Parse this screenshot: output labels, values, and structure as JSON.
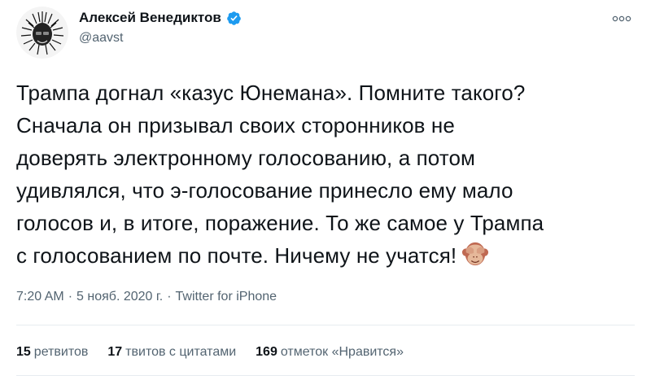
{
  "author": {
    "display_name": "Алексей Венедиктов",
    "handle": "@aavst",
    "verified_icon": "verified-badge-icon",
    "avatar_icon": "avatar-portrait"
  },
  "tweet": {
    "lines": [
      "Трампа догнал «казус Юнемана». Помните такого?",
      "Сначала он призывал своих сторонников не",
      "доверять электронному голосованию, а потом",
      "удивлялся, что э-голосование принесло ему мало",
      "голосов и, в итоге, поражение. То же самое у Трампа",
      "с голосованием по почте. Ничему не учатся!"
    ],
    "emoji": "see-no-evil-monkey-icon"
  },
  "meta": {
    "time": "7:20 AM",
    "date": "5 нояб. 2020 г.",
    "source": "Twitter for iPhone",
    "separator": "·"
  },
  "stats": {
    "retweets_count": "15",
    "retweets_label": "ретвитов",
    "quotes_count": "17",
    "quotes_label": "твитов с цитатами",
    "likes_count": "169",
    "likes_label": "отметок «Нравится»"
  },
  "colors": {
    "text": "#0f1419",
    "secondary": "#536471",
    "verified": "#1d9bf0",
    "divider": "#e6ecf0"
  }
}
